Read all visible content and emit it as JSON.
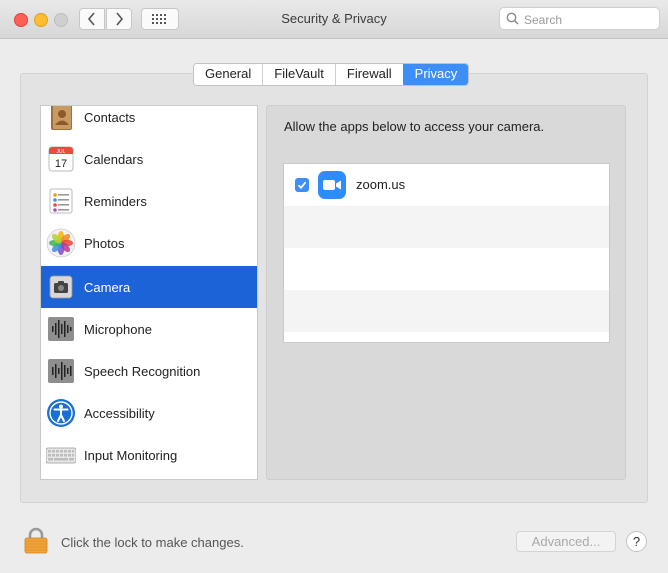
{
  "window": {
    "title": "Security & Privacy",
    "search_placeholder": "Search"
  },
  "tabs": [
    {
      "label": "General",
      "active": false
    },
    {
      "label": "FileVault",
      "active": false
    },
    {
      "label": "Firewall",
      "active": false
    },
    {
      "label": "Privacy",
      "active": true
    }
  ],
  "sidebar": {
    "items": [
      {
        "label": "Contacts",
        "icon": "contacts-icon",
        "selected": false
      },
      {
        "label": "Calendars",
        "icon": "calendar-icon",
        "selected": false,
        "calendar_month": "JUL",
        "calendar_day": "17"
      },
      {
        "label": "Reminders",
        "icon": "reminders-icon",
        "selected": false
      },
      {
        "label": "Photos",
        "icon": "photos-icon",
        "selected": false
      },
      {
        "label": "Camera",
        "icon": "camera-icon",
        "selected": true
      },
      {
        "label": "Microphone",
        "icon": "microphone-icon",
        "selected": false
      },
      {
        "label": "Speech Recognition",
        "icon": "speech-recognition-icon",
        "selected": false
      },
      {
        "label": "Accessibility",
        "icon": "accessibility-icon",
        "selected": false
      },
      {
        "label": "Input Monitoring",
        "icon": "keyboard-icon",
        "selected": false
      }
    ]
  },
  "content": {
    "description": "Allow the apps below to access your camera.",
    "apps": [
      {
        "name": "zoom.us",
        "checked": true,
        "icon": "zoom-icon"
      }
    ]
  },
  "footer": {
    "lock_text": "Click the lock to make changes.",
    "advanced_label": "Advanced...",
    "help_label": "?"
  },
  "colors": {
    "accent": "#3d8ef7",
    "selection": "#1d63d8",
    "zoom_blue": "#2d8cff"
  }
}
